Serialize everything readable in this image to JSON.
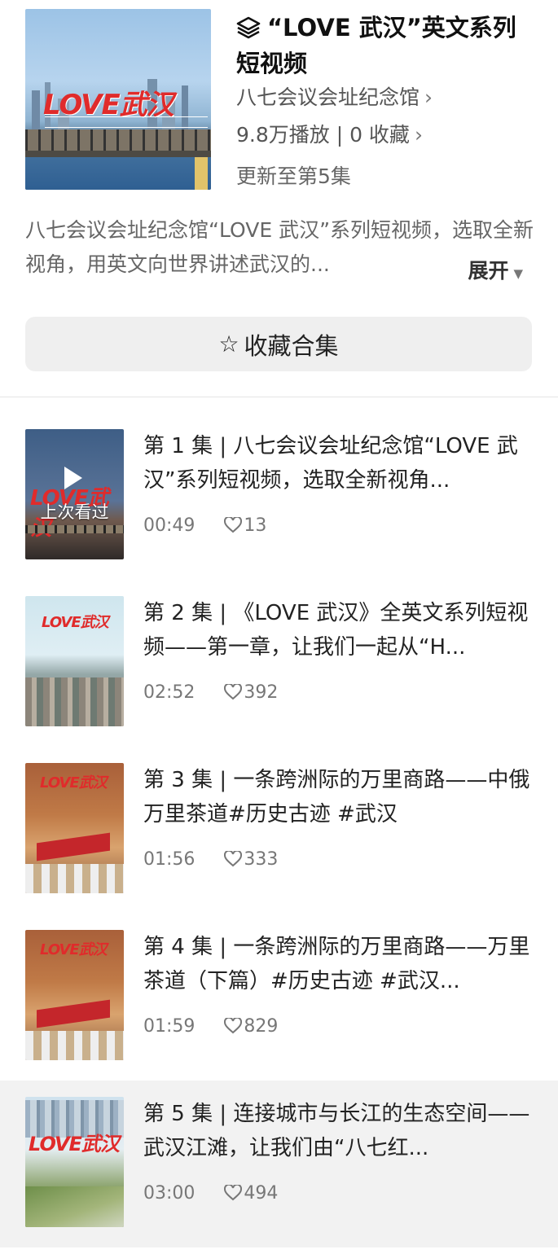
{
  "collection": {
    "title": "“LOVE 武汉”英文系列短视频",
    "author": "八七会议会址纪念馆",
    "stats": "9.8万播放 | 0 收藏",
    "update_status": "更新至第5集",
    "description": "八七会议会址纪念馆“LOVE 武汉”系列短视频，选取全新视角，用英文向世界讲述武汉的...",
    "expand_label": "展开",
    "favorite_button_label": "收藏合集",
    "cover_logo": "LOVE武汉"
  },
  "episodes": [
    {
      "title": "第 1 集 | 八七会议会址纪念馆“LOVE 武汉”系列短视频，选取全新视角...",
      "duration": "00:49",
      "likes": "13",
      "badge": "上次看过",
      "thumb_logo": "LOVE武汉"
    },
    {
      "title": "第 2 集 | 《LOVE 武汉》全英文系列短视频——第一章，让我们一起从“H...",
      "duration": "02:52",
      "likes": "392",
      "thumb_logo": "LOVE武汉"
    },
    {
      "title": "第 3 集 | 一条跨洲际的万里商路——中俄万里茶道#历史古迹 #武汉",
      "duration": "01:56",
      "likes": "333",
      "thumb_logo": "LOVE武汉"
    },
    {
      "title": "第 4 集 | 一条跨洲际的万里商路——万里茶道（下篇）#历史古迹 #武汉...",
      "duration": "01:59",
      "likes": "829",
      "thumb_logo": "LOVE武汉"
    },
    {
      "title": "第 5 集 | 连接城市与长江的生态空间——武汉江滩，让我们由“八七红...",
      "duration": "03:00",
      "likes": "494",
      "thumb_logo": "LOVE武汉"
    }
  ],
  "colors": {
    "brand_red": "#e02b2b",
    "active_row_bg": "#f2f2f2",
    "button_bg": "#efefef"
  }
}
